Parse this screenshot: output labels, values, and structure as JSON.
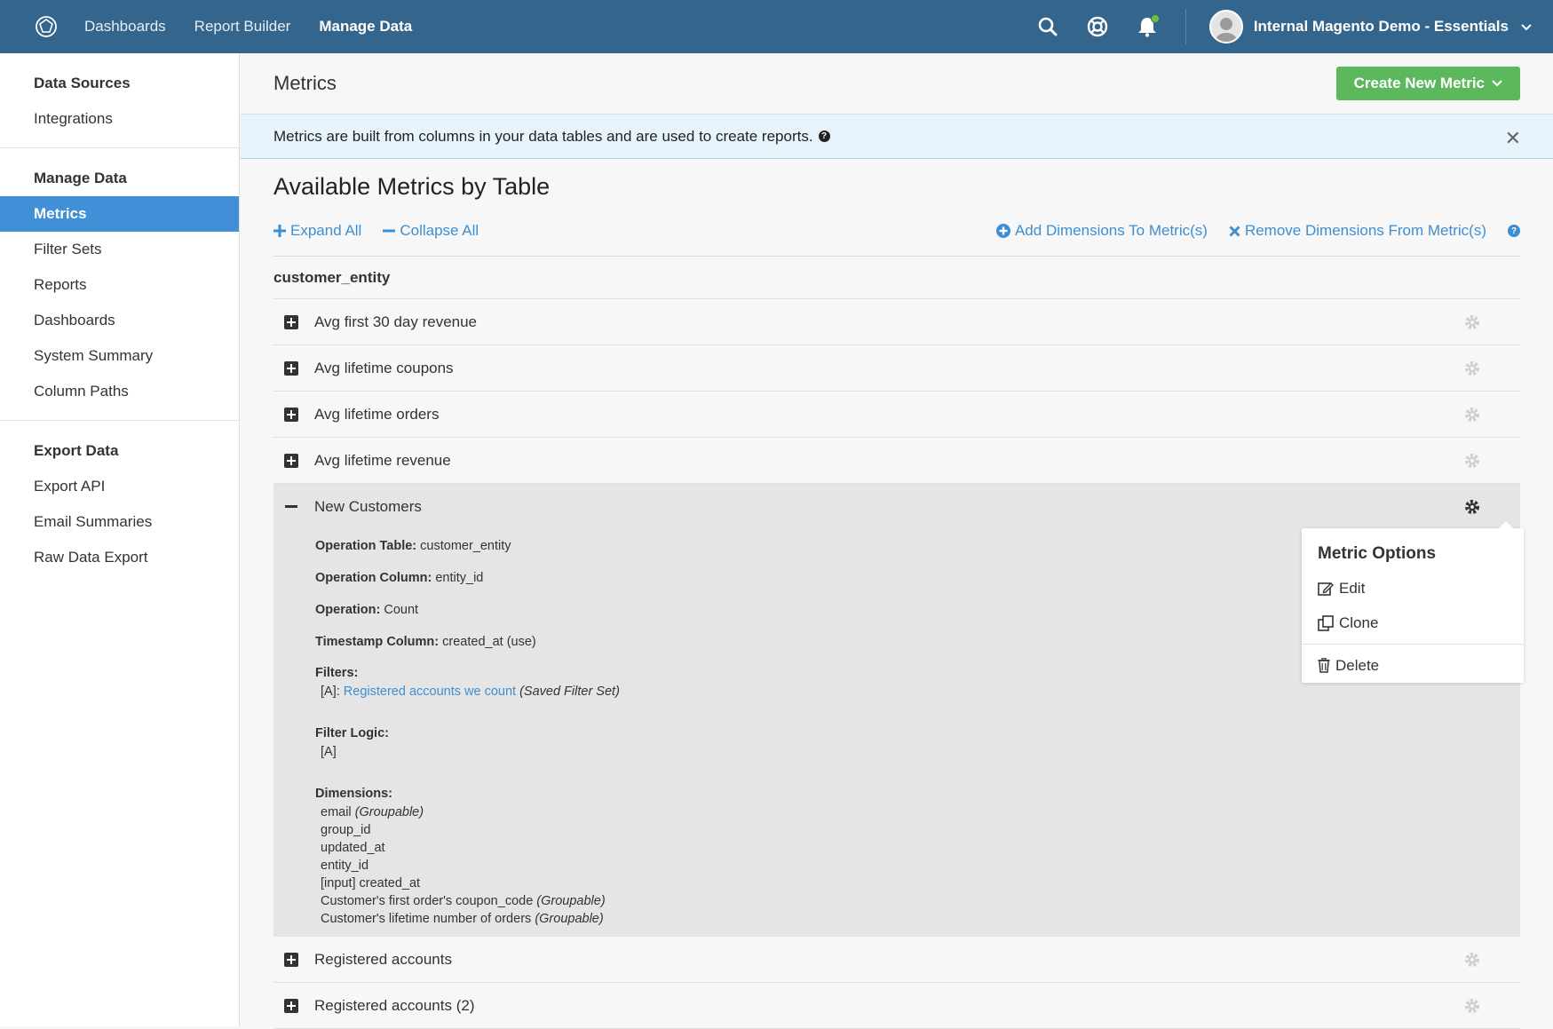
{
  "topnav": {
    "links": [
      "Dashboards",
      "Report Builder",
      "Manage Data"
    ],
    "account_name": "Internal Magento Demo - Essentials"
  },
  "sidebar": {
    "sections": [
      {
        "heading": "Data Sources",
        "items": [
          "Integrations"
        ]
      },
      {
        "heading": "Manage Data",
        "items": [
          "Metrics",
          "Filter Sets",
          "Reports",
          "Dashboards",
          "System Summary",
          "Column Paths"
        ]
      },
      {
        "heading": "Export Data",
        "items": [
          "Export API",
          "Email Summaries",
          "Raw Data Export"
        ]
      }
    ],
    "active_item": "Metrics"
  },
  "page": {
    "title": "Metrics",
    "create_button": "Create New Metric",
    "info_text": "Metrics are built from columns in your data tables and are used to create reports.",
    "section_title": "Available Metrics by Table",
    "toolbar": {
      "expand_all": "Expand All",
      "collapse_all": "Collapse All",
      "add_dimensions": "Add Dimensions To Metric(s)",
      "remove_dimensions": "Remove Dimensions From Metric(s)"
    }
  },
  "table": {
    "name": "customer_entity",
    "rows_before": [
      "Avg first 30 day revenue",
      "Avg lifetime coupons",
      "Avg lifetime orders",
      "Avg lifetime revenue"
    ],
    "expanded": {
      "label": "New Customers",
      "operation_table_label": "Operation Table:",
      "operation_table": "customer_entity",
      "operation_column_label": "Operation Column:",
      "operation_column": "entity_id",
      "operation_label": "Operation:",
      "operation": "Count",
      "timestamp_label": "Timestamp Column:",
      "timestamp": "created_at (use)",
      "filters_label": "Filters:",
      "filter_prefix": "[A]:",
      "filter_link": "Registered accounts we count",
      "filter_suffix": "(Saved Filter Set)",
      "filter_logic_label": "Filter Logic:",
      "filter_logic": "[A]",
      "dimensions_label": "Dimensions:",
      "dimensions": [
        {
          "name": "email",
          "note": "(Groupable)"
        },
        {
          "name": "group_id",
          "note": ""
        },
        {
          "name": "updated_at",
          "note": ""
        },
        {
          "name": "entity_id",
          "note": ""
        },
        {
          "name": "[input] created_at",
          "note": ""
        },
        {
          "name": "Customer's first order's coupon_code",
          "note": "(Groupable)"
        },
        {
          "name": "Customer's lifetime number of orders",
          "note": "(Groupable)"
        }
      ]
    },
    "rows_after": [
      "Registered accounts",
      "Registered accounts (2)"
    ]
  },
  "metric_options": {
    "title": "Metric Options",
    "edit": "Edit",
    "clone": "Clone",
    "delete": "Delete"
  },
  "colors": {
    "nav_bg": "#34658c",
    "active_blue": "#4190d7",
    "link_blue": "#3d8fd2",
    "create_green": "#5cb85c"
  }
}
